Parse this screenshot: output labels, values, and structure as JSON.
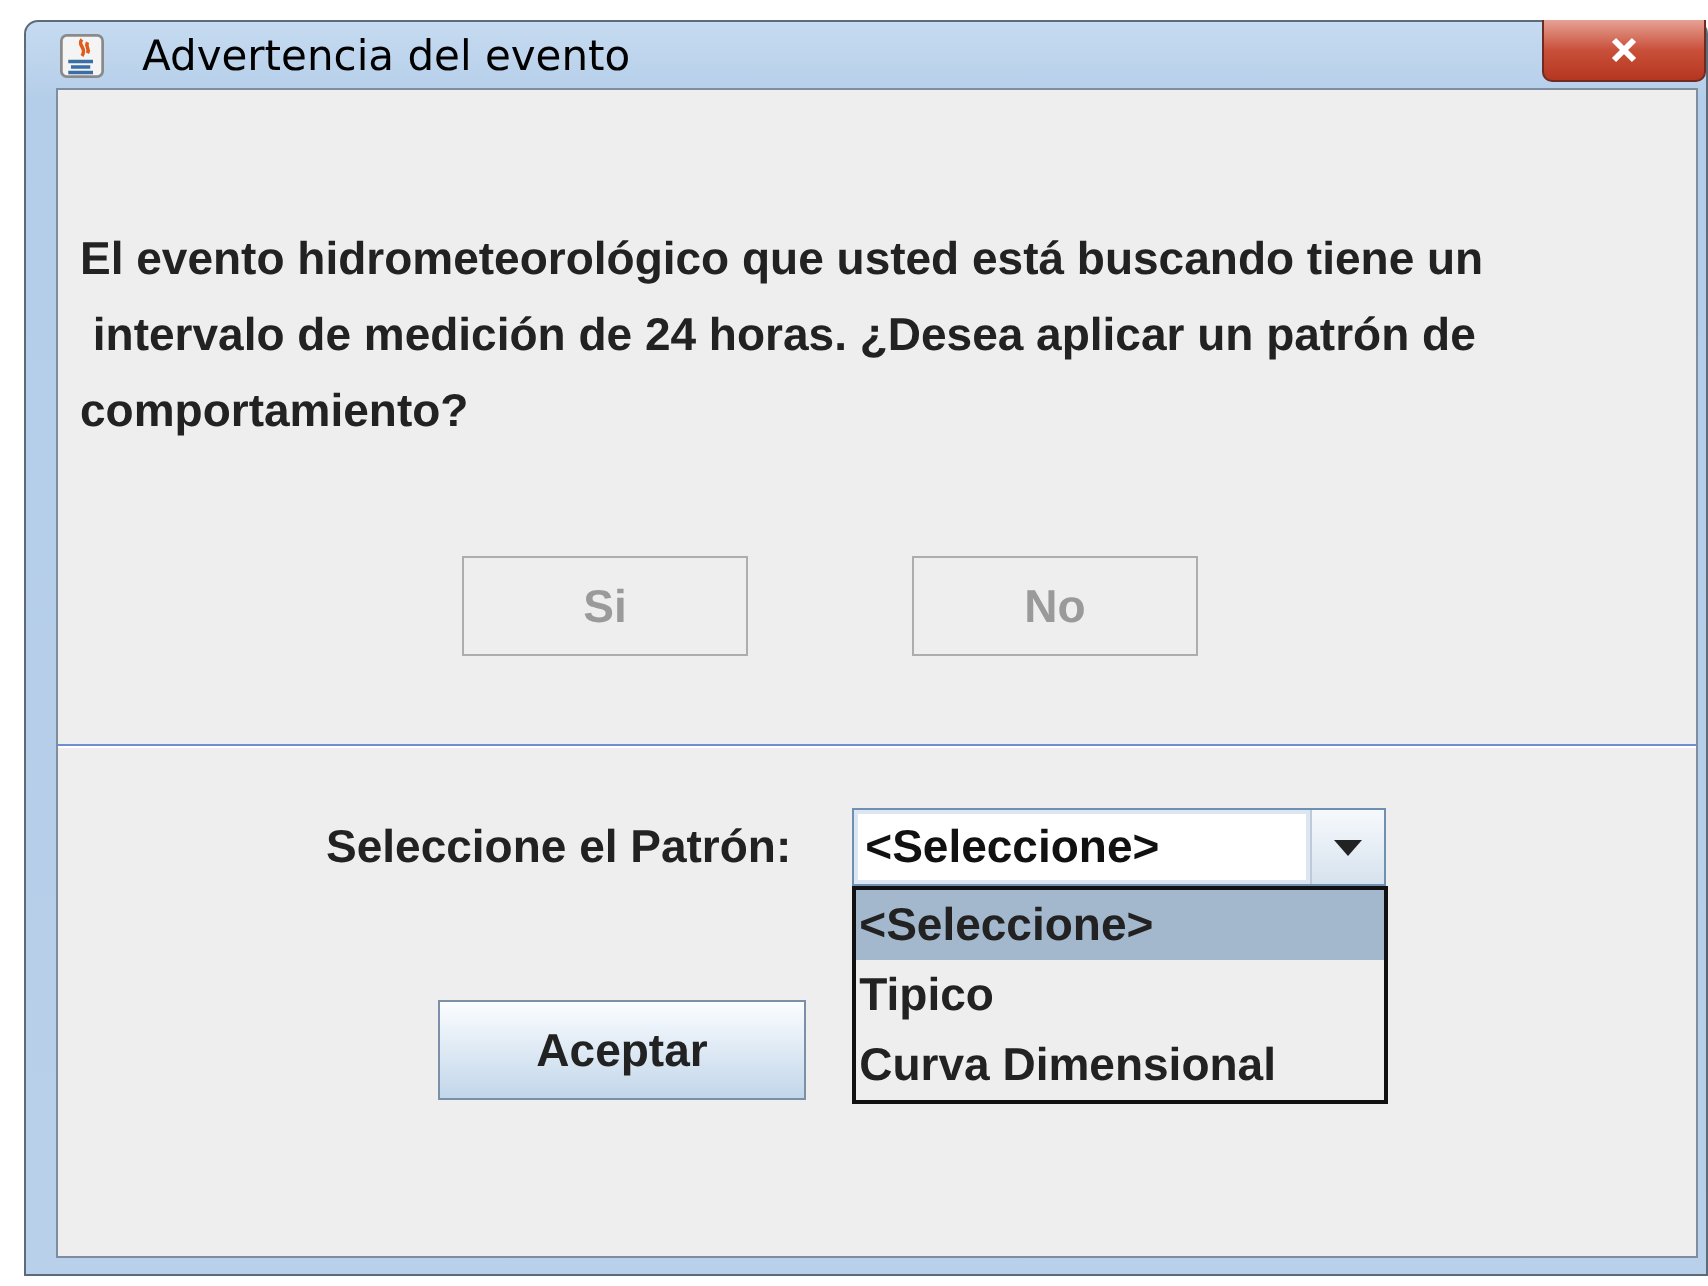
{
  "window": {
    "title": "Advertencia del evento"
  },
  "message": "El evento hidrometeorológico que usted está buscando tiene un\n intervalo de medición de 24 horas. ¿Desea aplicar un patrón de\ncomportamiento?",
  "buttons": [
    {
      "label": "Si",
      "disabled": true
    },
    {
      "label": "No",
      "disabled": true
    }
  ],
  "pattern": {
    "label": "Seleccione el Patrón:",
    "value": "<Seleccione>",
    "expanded": true,
    "options": [
      {
        "label": "<Seleccione>",
        "selected": true
      },
      {
        "label": "Tipico",
        "selected": false
      },
      {
        "label": "Curva Dimensional",
        "selected": false
      }
    ]
  },
  "accept_button": {
    "label": "Aceptar"
  }
}
